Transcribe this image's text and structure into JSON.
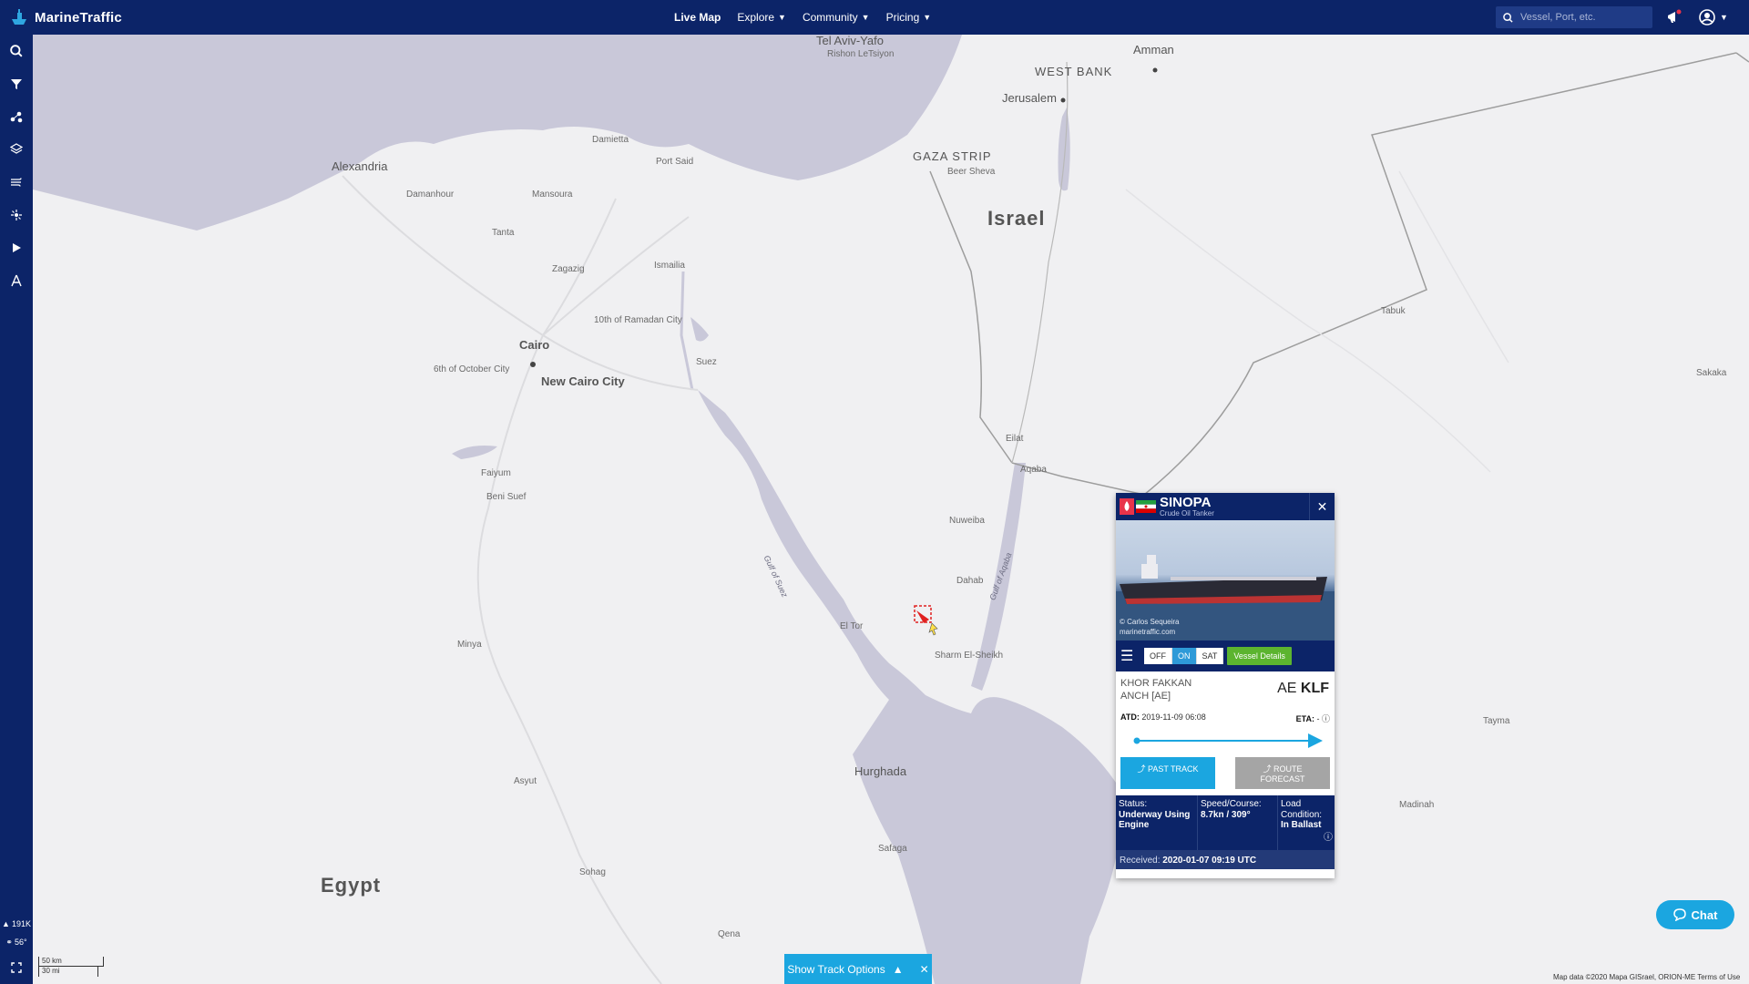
{
  "app": {
    "name": "MarineTraffic"
  },
  "nav": {
    "items": [
      {
        "label": "Live Map",
        "has_dropdown": false
      },
      {
        "label": "Explore",
        "has_dropdown": true
      },
      {
        "label": "Community",
        "has_dropdown": true
      },
      {
        "label": "Pricing",
        "has_dropdown": true
      }
    ]
  },
  "search": {
    "placeholder": "Vessel, Port, etc."
  },
  "sidebar": {
    "icons": [
      "search-icon",
      "filter-icon",
      "fleet-icon",
      "layers-icon",
      "weather-icon",
      "density-icon",
      "playback-icon",
      "measure-icon"
    ],
    "vessel_count": "191K",
    "compass": "56°"
  },
  "popup": {
    "vessel_name": "SINOPA",
    "vessel_type": "Crude Oil Tanker",
    "photo_credit": "© Carlos Sequeira",
    "photo_site": "marinetraffic.com",
    "toggle": {
      "off": "OFF",
      "on": "ON",
      "sat": "SAT",
      "selected": "ON"
    },
    "details_label": "Vessel Details",
    "departure_port_line1": "KHOR FAKKAN",
    "departure_port_line2": "ANCH [AE]",
    "country_code": "AE",
    "port_code": "KLF",
    "atd_label": "ATD:",
    "atd_value": "2019-11-09 06:08",
    "eta_label": "ETA:",
    "eta_value": "-",
    "past_track_label": "PAST TRACK",
    "route_forecast_label": "ROUTE FORECAST",
    "status_label": "Status:",
    "status_value": "Underway Using Engine",
    "speed_label": "Speed/Course:",
    "speed_value": "8.7kn / 309°",
    "load_label": "Load Condition:",
    "load_value": "In Ballast",
    "received_label": "Received:",
    "received_value": "2020-01-07 09:19 UTC"
  },
  "bottom": {
    "track_options": "Show Track Options",
    "chat": "Chat",
    "scale_km": "50 km",
    "scale_mi": "30 mi",
    "attribution": "Map data ©2020 Mapa GISrael, ORION-ME   Terms of Use"
  },
  "map_labels": {
    "countries": [
      "Israel",
      "Egypt"
    ],
    "regions": [
      "WEST BANK",
      "GAZA STRIP"
    ],
    "cities": [
      "Tel Aviv-Yafo",
      "Rishon LeTsiyon",
      "Jerusalem",
      "Amman",
      "Alexandria",
      "Damanhour",
      "Mansoura",
      "Tanta",
      "Zagazig",
      "Ismailia",
      "Port Said",
      "Damietta",
      "Cairo",
      "New Cairo City",
      "6th of October City",
      "10th of Ramadan City",
      "Suez",
      "Faiyum",
      "Beni Suef",
      "Minya",
      "Asyut",
      "Sohag",
      "Qena",
      "Hurghada",
      "Safaga",
      "El Tor",
      "Sharm El-Sheikh",
      "Beer Sheva",
      "Eilat",
      "Aqaba",
      "Tabuk",
      "Dahab",
      "Nuweiba",
      "Madinah",
      "Tayma",
      "Sakaka"
    ],
    "water": [
      "Gulf of Suez",
      "Gulf of Aqaba"
    ]
  },
  "colors": {
    "nav_bg": "#0c2468",
    "water": "#c9c8d9",
    "land": "#f0f0f2",
    "accent": "#1ba6e0",
    "details_green": "#5cb42f"
  }
}
